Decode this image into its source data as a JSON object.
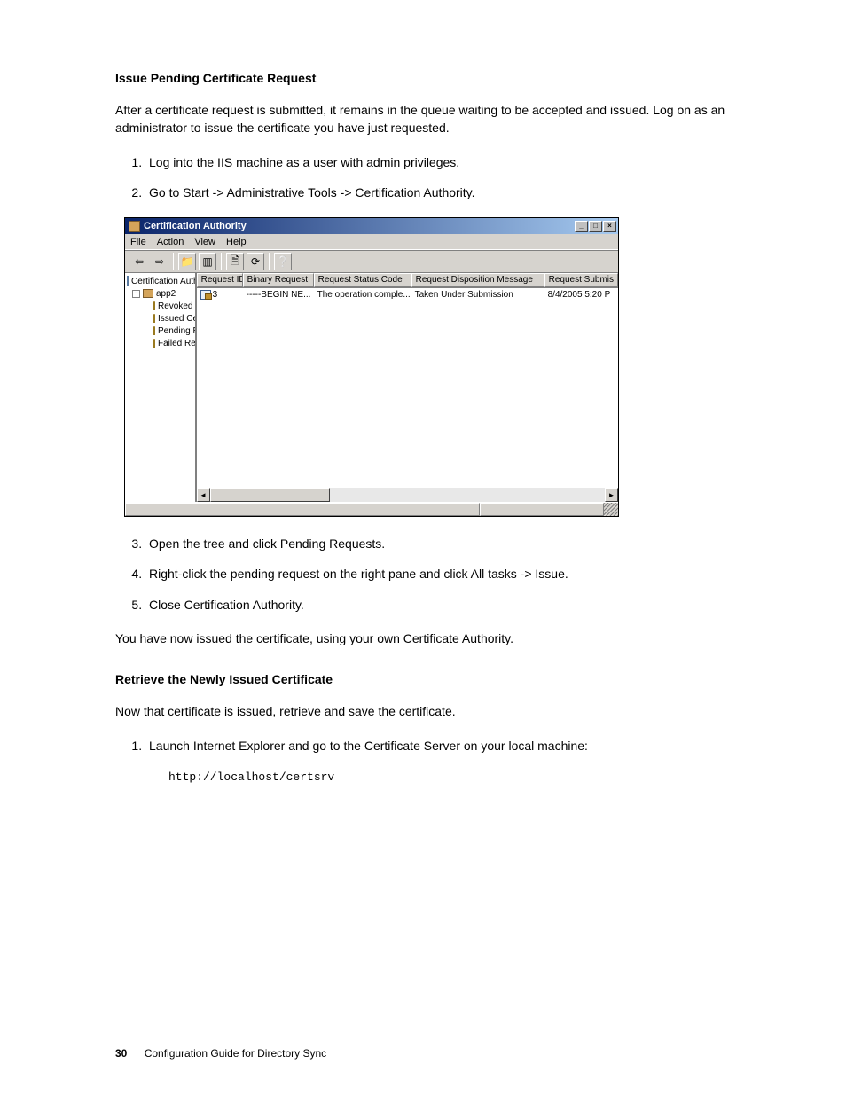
{
  "section1": {
    "heading": "Issue Pending Certificate Request",
    "intro": "After a certificate request is submitted, it remains in the queue waiting to be accepted and issued. Log on as an administrator to issue the certificate you have just requested.",
    "steps_a": [
      "Log into the IIS machine as a user with admin privileges.",
      "Go to Start -> Administrative Tools -> Certification Authority."
    ],
    "steps_b": [
      "Open the tree and click Pending Requests.",
      "Right-click the pending request on the right pane and click All tasks -> Issue.",
      "Close Certification Authority."
    ],
    "closing": "You have now issued the certificate, using your own Certificate Authority."
  },
  "section2": {
    "heading": "Retrieve the Newly Issued Certificate",
    "intro": "Now that certificate is issued, retrieve and save the certificate.",
    "steps": [
      "Launch Internet Explorer and go to the Certificate Server on your local machine:"
    ],
    "code": "http://localhost/certsrv"
  },
  "footer": {
    "page_num": "30",
    "doc_title": "Configuration Guide for Directory Sync"
  },
  "screenshot": {
    "title": "Certification Authority",
    "win_min": "_",
    "win_max": "□",
    "win_close": "×",
    "menu": {
      "file": "File",
      "action": "Action",
      "view": "View",
      "help": "Help"
    },
    "tree": {
      "root": "Certification Authority (Local)",
      "ca_name": "app2",
      "revoked": "Revoked Certificates",
      "issued": "Issued Certificates",
      "pending": "Pending Requests",
      "failed": "Failed Requests"
    },
    "columns": {
      "c1": "Request ID",
      "c2": "Binary Request",
      "c3": "Request Status Code",
      "c4": "Request Disposition Message",
      "c5": "Request Submis"
    },
    "row": {
      "id": "3",
      "binary": "-----BEGIN NE...",
      "status": "The operation comple...",
      "disposition": "Taken Under Submission",
      "submitted": "8/4/2005 5:20 P"
    },
    "scroll_left": "◄",
    "scroll_right": "►"
  }
}
